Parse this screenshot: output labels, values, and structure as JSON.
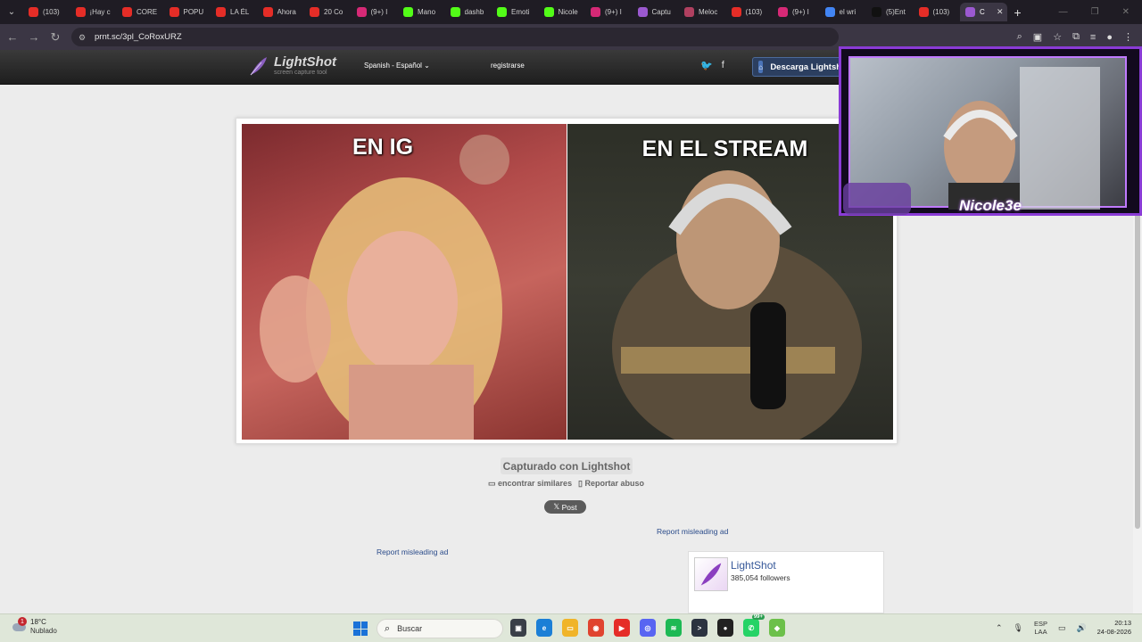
{
  "browser": {
    "tabs": [
      {
        "title": "(103)",
        "icon": "youtube-icon",
        "color": "#e52d27"
      },
      {
        "title": "¡Hay c",
        "icon": "youtube-icon",
        "color": "#e52d27"
      },
      {
        "title": "CORE",
        "icon": "youtube-icon",
        "color": "#e52d27"
      },
      {
        "title": "POPU",
        "icon": "youtube-icon",
        "color": "#e52d27"
      },
      {
        "title": "LA ÉL",
        "icon": "youtube-icon",
        "color": "#e52d27"
      },
      {
        "title": "Ahora",
        "icon": "youtube-icon",
        "color": "#e52d27"
      },
      {
        "title": "20 Co",
        "icon": "youtube-icon",
        "color": "#e52d27"
      },
      {
        "title": "(9+) I",
        "icon": "instagram-icon",
        "color": "#d62976"
      },
      {
        "title": "Mano",
        "icon": "kick-icon",
        "color": "#53fc18"
      },
      {
        "title": "dashb",
        "icon": "kick-icon",
        "color": "#53fc18"
      },
      {
        "title": "Emoti",
        "icon": "kick-icon",
        "color": "#53fc18"
      },
      {
        "title": "Nicole",
        "icon": "kick-icon",
        "color": "#53fc18"
      },
      {
        "title": "(9+) I",
        "icon": "instagram-icon",
        "color": "#d62976"
      },
      {
        "title": "Captu",
        "icon": "lightshot-icon",
        "color": "#9b59d0"
      },
      {
        "title": "Meloc",
        "icon": "mail-icon",
        "color": "#b04060"
      },
      {
        "title": "(103)",
        "icon": "youtube-icon",
        "color": "#e52d27"
      },
      {
        "title": "(9+) I",
        "icon": "instagram-icon",
        "color": "#d62976"
      },
      {
        "title": "el wri",
        "icon": "google-icon",
        "color": "#4285f4"
      },
      {
        "title": "(5)Ent",
        "icon": "tiktok-icon",
        "color": "#111111"
      },
      {
        "title": "(103)",
        "icon": "youtube-icon",
        "color": "#e52d27"
      },
      {
        "title": "C",
        "icon": "lightshot-icon",
        "color": "#9b59d0",
        "active": true
      }
    ],
    "url": "prnt.sc/3pl_CoRoxURZ"
  },
  "site": {
    "logo_name": "LightShot",
    "logo_tagline": "screen capture tool",
    "language": "Spanish - Español",
    "register": "registrarse",
    "download": "Descarga Lightshot"
  },
  "meme": {
    "left_caption": "EN IG",
    "right_caption": "EN EL STREAM"
  },
  "page": {
    "captured_with": "Capturado con Lightshot",
    "find_similar": "encontrar similares",
    "report_abuse": "Reportar abuso",
    "post": "Post",
    "report_ad": "Report misleading ad"
  },
  "facebook_widget": {
    "name": "LightShot",
    "followers": "385,054 followers"
  },
  "stream_overlay": {
    "streamer": "Nicole3e"
  },
  "taskbar": {
    "weather_temp": "18°C",
    "weather_desc": "Nublado",
    "weather_badge": "1",
    "search_placeholder": "Buscar",
    "language": "ESP",
    "keyboard": "LAA",
    "time": "20:13",
    "date": "24-08-2026",
    "whatsapp_badge": "99+"
  }
}
